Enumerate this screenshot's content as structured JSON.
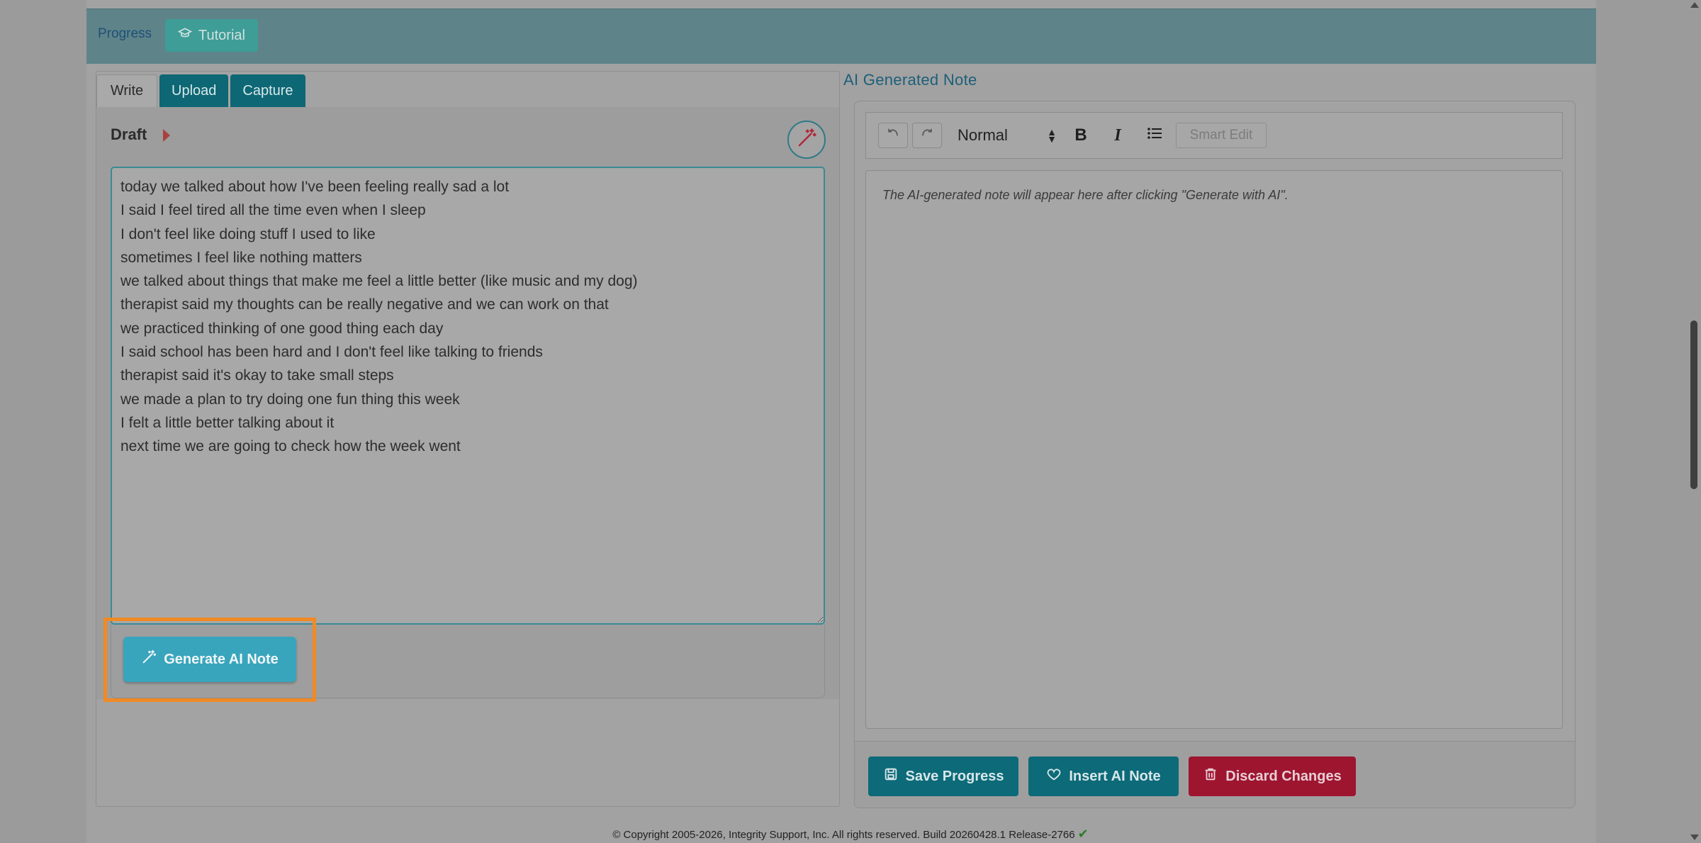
{
  "topbar": {
    "progress_label": "Progress",
    "tutorial_label": "Tutorial"
  },
  "left": {
    "tabs": [
      {
        "label": "Write",
        "active": true
      },
      {
        "label": "Upload",
        "active": false
      },
      {
        "label": "Capture",
        "active": false
      }
    ],
    "draft_label": "Draft",
    "draft_text": "today we talked about how I've been feeling really sad a lot\nI said I feel tired all the time even when I sleep\nI don't feel like doing stuff I used to like\nsometimes I feel like nothing matters\nwe talked about things that make me feel a little better (like music and my dog)\ntherapist said my thoughts can be really negative and we can work on that\nwe practiced thinking of one good thing each day\nI said school has been hard and I don't feel like talking to friends\ntherapist said it's okay to take small steps\nwe made a plan to try doing one fun thing this week\nI felt a little better talking about it\nnext time we are going to check how the week went",
    "generate_label": "Generate AI Note"
  },
  "right": {
    "title": "AI Generated Note",
    "toolbar": {
      "style_select": "Normal",
      "bold": "B",
      "italic": "I",
      "smart_edit_label": "Smart Edit"
    },
    "editor_placeholder": "The AI-generated note will appear here after clicking \"Generate with AI\".",
    "buttons": {
      "save_label": "Save Progress",
      "insert_label": "Insert AI Note",
      "discard_label": "Discard Changes"
    }
  },
  "footer": {
    "copyright": "© Copyright 2005-2026, Integrity Support, Inc. All rights reserved. Build 20260428.1 Release-2766"
  },
  "colors": {
    "teal": "#0d6a78",
    "generate": "#38a5bd",
    "discard": "#9e1530",
    "highlight": "#f08a24"
  }
}
